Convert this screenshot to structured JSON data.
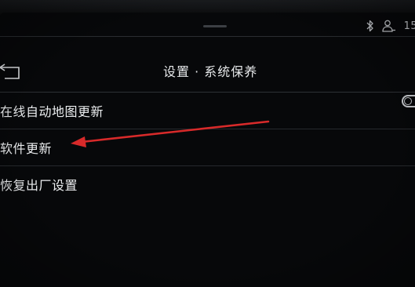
{
  "status_bar": {
    "time": "15:",
    "bluetooth_icon": "bluetooth-icon",
    "profile_icon": "user-profile-icon"
  },
  "header": {
    "back_icon": "back-arrow-icon",
    "title": "设置 · 系统保养"
  },
  "settings_list": {
    "items": [
      {
        "label": "在线自动地图更新",
        "control": "toggle",
        "toggle_on": false
      },
      {
        "label": "软件更新"
      },
      {
        "label": "恢复出厂设置"
      }
    ]
  },
  "annotation": {
    "arrow_color": "#d82a2a",
    "points_to": "软件更新"
  },
  "colors": {
    "background": "#07080a",
    "text": "#eceef0",
    "divider": "#26292d"
  }
}
